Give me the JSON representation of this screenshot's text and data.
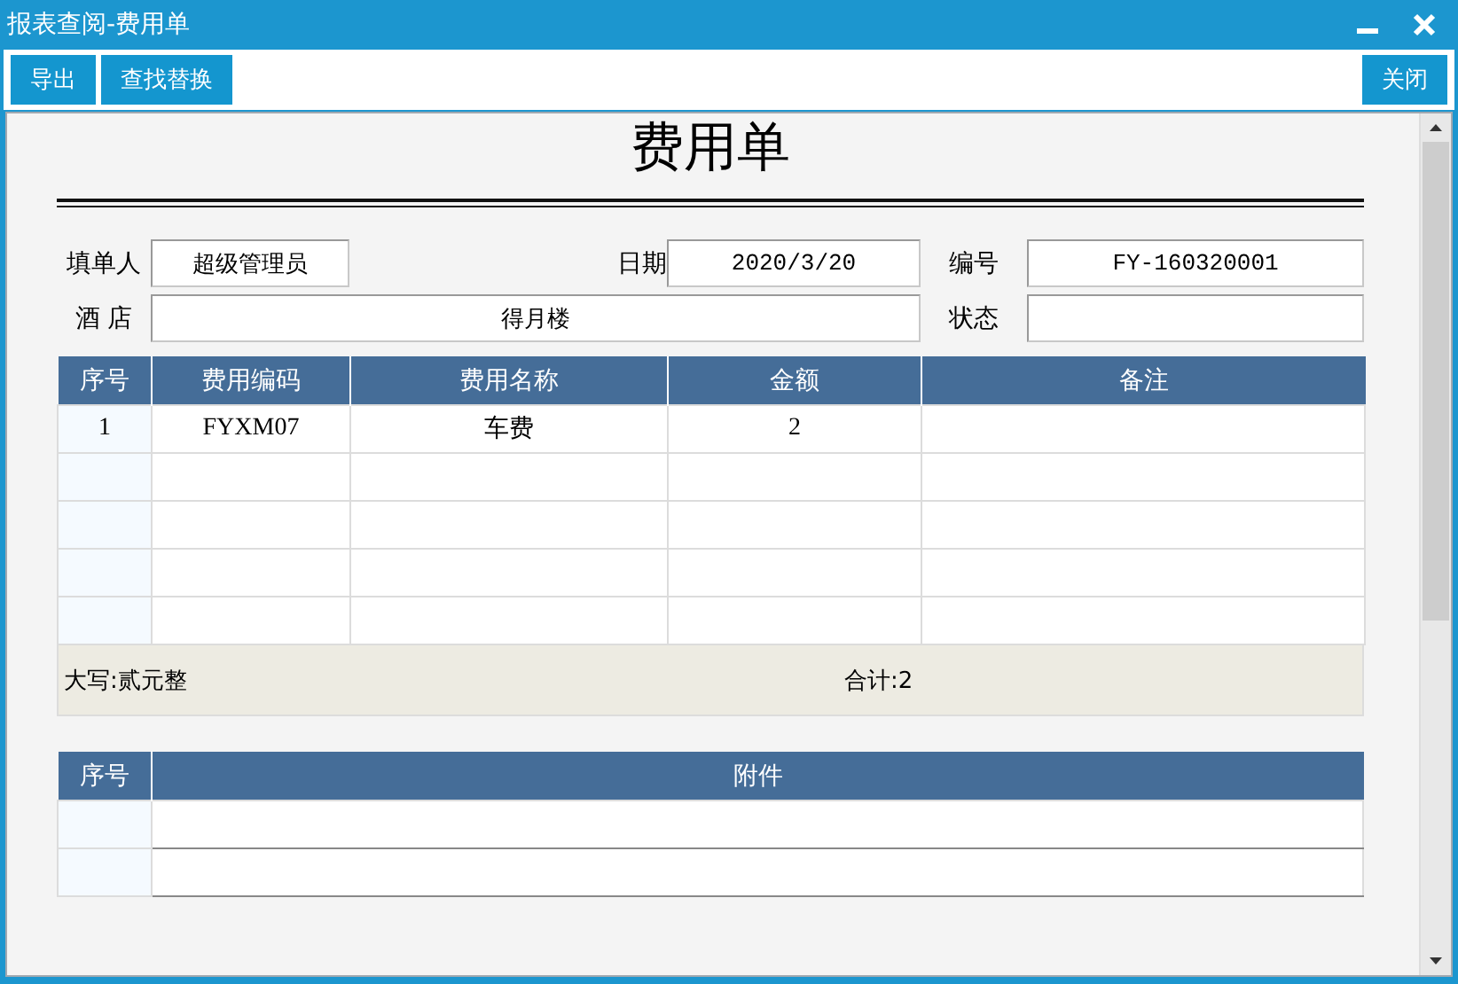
{
  "window": {
    "title": "报表查阅-费用单"
  },
  "toolbar": {
    "left_buttons": [
      "导出",
      "查找替换"
    ],
    "right_buttons": [
      "关闭"
    ]
  },
  "document": {
    "title": "费用单",
    "fields": [
      {
        "label": "填单人",
        "value": "超级管理员"
      },
      {
        "label": "日期",
        "value": "2020/3/20"
      },
      {
        "label": "编号",
        "value": "FY-160320001"
      },
      {
        "label": "酒 店",
        "value": "得月楼"
      },
      {
        "label": "状态"
      }
    ]
  },
  "items_table": {
    "columns": [
      "序号",
      "费用编码",
      "费用名称",
      "金额",
      "备注"
    ],
    "rows": [
      [
        "1",
        "FYXM07",
        "车费",
        "2"
      ]
    ]
  },
  "summary": {
    "in_words": "大写:贰元整",
    "total": "合计:2"
  },
  "attachments_table": {
    "columns": [
      "序号",
      "附件"
    ]
  }
}
